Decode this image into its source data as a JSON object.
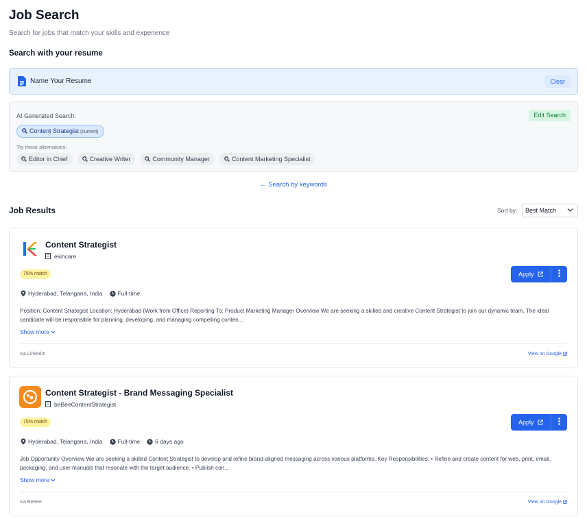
{
  "header": {
    "title": "Job Search",
    "subtitle": "Search for jobs that match your skills and experience"
  },
  "resume": {
    "section_title": "Search with your resume",
    "name": "Name Your Resume",
    "clear_label": "Clear",
    "icon": "document-icon"
  },
  "ai_search": {
    "label": "AI Generated Search:",
    "edit_label": "Edit Search",
    "current_query": "Content Strategist",
    "current_tag": "(current)",
    "alternatives_label": "Try these alternatives:",
    "alternatives": [
      "Editor in Chief",
      "Creative Writer",
      "Community Manager",
      "Content Marketing Specialist"
    ]
  },
  "keywords_link": "← Search by keywords",
  "results": {
    "title": "Job Results",
    "sort_label": "Sort by:",
    "sort_value": "Best Match"
  },
  "jobs": [
    {
      "title": "Content Strategist",
      "company": "ekincare",
      "match": "75% match",
      "apply_label": "Apply",
      "location": "Hyderabad, Telangana, India",
      "job_type": "Full-time",
      "posted": "",
      "description": "Position: Content Strategist Location: Hyderabad (Work from Office) Reporting To: Product Marketing Manager Overview We are seeking a skilled and creative Content Strategist to join our dynamic team. The ideal candidate will be responsible for planning, developing, and managing compelling conten...",
      "show_more": "Show more",
      "via": "via LinkedIn",
      "google_link": "View on Google"
    },
    {
      "title": "Content Strategist - Brand Messaging Specialist",
      "company": "beBeeContentStrategist",
      "match": "75% match",
      "apply_label": "Apply",
      "location": "Hyderabad, Telangana, India",
      "job_type": "Full-time",
      "posted": "6 days ago",
      "description": "Job Opportunity Overview We are seeking a skilled Content Strategist to develop and refine brand-aligned messaging across various platforms. Key Responsibilities: • Refine and create content for web, print, email, packaging, and user manuals that resonate with the target audience. • Publish con...",
      "show_more": "Show more",
      "via": "via BeBee",
      "google_link": "View on Google"
    }
  ],
  "colors": {
    "accent": "#2563eb",
    "match_badge": "#fef3a0",
    "resume_bg": "#e8f2fd",
    "edit_bg": "#d7f5e3"
  }
}
